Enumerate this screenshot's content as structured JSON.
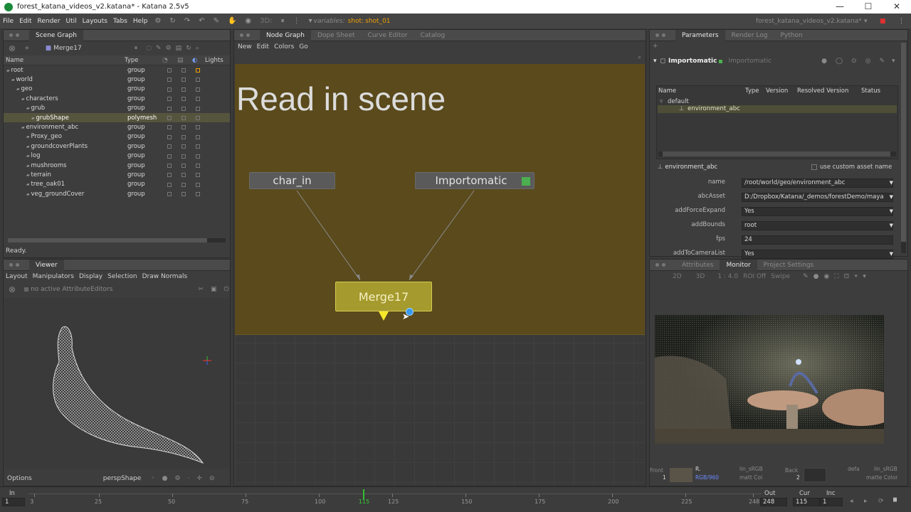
{
  "window": {
    "title": "forest_katana_videos_v2.katana* - Katana 2.5v5",
    "min": "—",
    "max": "☐",
    "close": "✕"
  },
  "menu": [
    "File",
    "Edit",
    "Render",
    "Util",
    "Layouts",
    "Tabs",
    "Help"
  ],
  "toolbar": {
    "mode_3d": "3D:",
    "variables_label": "variables:",
    "shot_label": "shot",
    "shot_value": "shot_01",
    "project_name": "forest_katana_videos_v2.katana*"
  },
  "scene_graph": {
    "tab": "Scene Graph",
    "node_label": "Merge17",
    "columns": [
      "Name",
      "Type",
      "Lights"
    ],
    "rows": [
      {
        "name": "root",
        "type": "group",
        "depth": 0
      },
      {
        "name": "world",
        "type": "group",
        "depth": 1
      },
      {
        "name": "geo",
        "type": "group",
        "depth": 2
      },
      {
        "name": "characters",
        "type": "group",
        "depth": 3
      },
      {
        "name": "grub",
        "type": "group",
        "depth": 4
      },
      {
        "name": "grubShape",
        "type": "polymesh",
        "depth": 5,
        "selected": true
      },
      {
        "name": "environment_abc",
        "type": "group",
        "depth": 3
      },
      {
        "name": "Proxy_geo",
        "type": "group",
        "depth": 4
      },
      {
        "name": "groundcoverPlants",
        "type": "group",
        "depth": 4
      },
      {
        "name": "log",
        "type": "group",
        "depth": 4
      },
      {
        "name": "mushrooms",
        "type": "group",
        "depth": 4
      },
      {
        "name": "terrain",
        "type": "group",
        "depth": 4
      },
      {
        "name": "tree_oak01",
        "type": "group",
        "depth": 4
      },
      {
        "name": "veg_groundCover",
        "type": "group",
        "depth": 4
      }
    ],
    "status": "Ready."
  },
  "viewer": {
    "tab": "Viewer",
    "menu": [
      "Layout",
      "Manipulators",
      "Display",
      "Selection",
      "Draw Normals"
    ],
    "no_editors": "no active AttributeEditors",
    "options": "Options",
    "camera": "perspShape"
  },
  "node_graph": {
    "tabs": [
      "Node Graph",
      "Dope Sheet",
      "Curve Editor",
      "Catalog"
    ],
    "menu": [
      "New",
      "Edit",
      "Colors",
      "Go"
    ],
    "backdrop_title": "Read in scene",
    "nodes": {
      "char_in": "char_in",
      "importomatic": "Importomatic",
      "merge": "Merge17"
    }
  },
  "parameters": {
    "tabs": [
      "Parameters",
      "Render Log",
      "Python"
    ],
    "node_name": "Importomatic",
    "node_type": "Importomatic",
    "table_columns": [
      "Name",
      "Type",
      "Version",
      "Resolved Version",
      "Status"
    ],
    "tree": [
      "default",
      "environment_abc"
    ],
    "section": "environment_abc",
    "use_custom": "use custom asset name",
    "fields": [
      {
        "label": "name",
        "value": "/root/world/geo/environment_abc",
        "dropdown": true
      },
      {
        "label": "abcAsset",
        "value": "D:/Dropbox/Katana/_demos/forestDemo/maya",
        "dropdown": true
      },
      {
        "label": "addForceExpand",
        "value": "Yes",
        "dropdown": true
      },
      {
        "label": "addBounds",
        "value": "root",
        "dropdown": true
      },
      {
        "label": "fps",
        "value": "24",
        "dropdown": false
      },
      {
        "label": "addToCameraList",
        "value": "Yes",
        "dropdown": true
      }
    ]
  },
  "monitor": {
    "tabs": [
      "Attributes",
      "Monitor",
      "Project Settings"
    ],
    "toolbar": [
      "2D",
      "3D",
      "1 : 4.0",
      "ROI Off",
      "Swipe"
    ],
    "front_label": "Front",
    "front_num": "1",
    "r_label": "R.",
    "channels": "RGB/960",
    "lut1": "lin_sRGB",
    "lut2": "matt Col",
    "back_label": "Back",
    "back_num": "2",
    "defs": "defa",
    "lut3": "lin_sRGB",
    "lut4": "matte Color"
  },
  "timeline": {
    "in_label": "In",
    "in_value": "1",
    "ticks": [
      "3",
      "25",
      "50",
      "75",
      "100",
      "115",
      "125",
      "150",
      "175",
      "200",
      "225",
      "248"
    ],
    "out_label": "Out",
    "out_value": "248",
    "cur_label": "Cur",
    "cur_value": "115",
    "inc_label": "Inc",
    "inc_value": "1",
    "current_frame": 115,
    "range": [
      1,
      248
    ]
  },
  "colors": {
    "backdrop": "#5a4a1c",
    "merge_node": "#a59a2e",
    "accent": "#f0a000"
  }
}
